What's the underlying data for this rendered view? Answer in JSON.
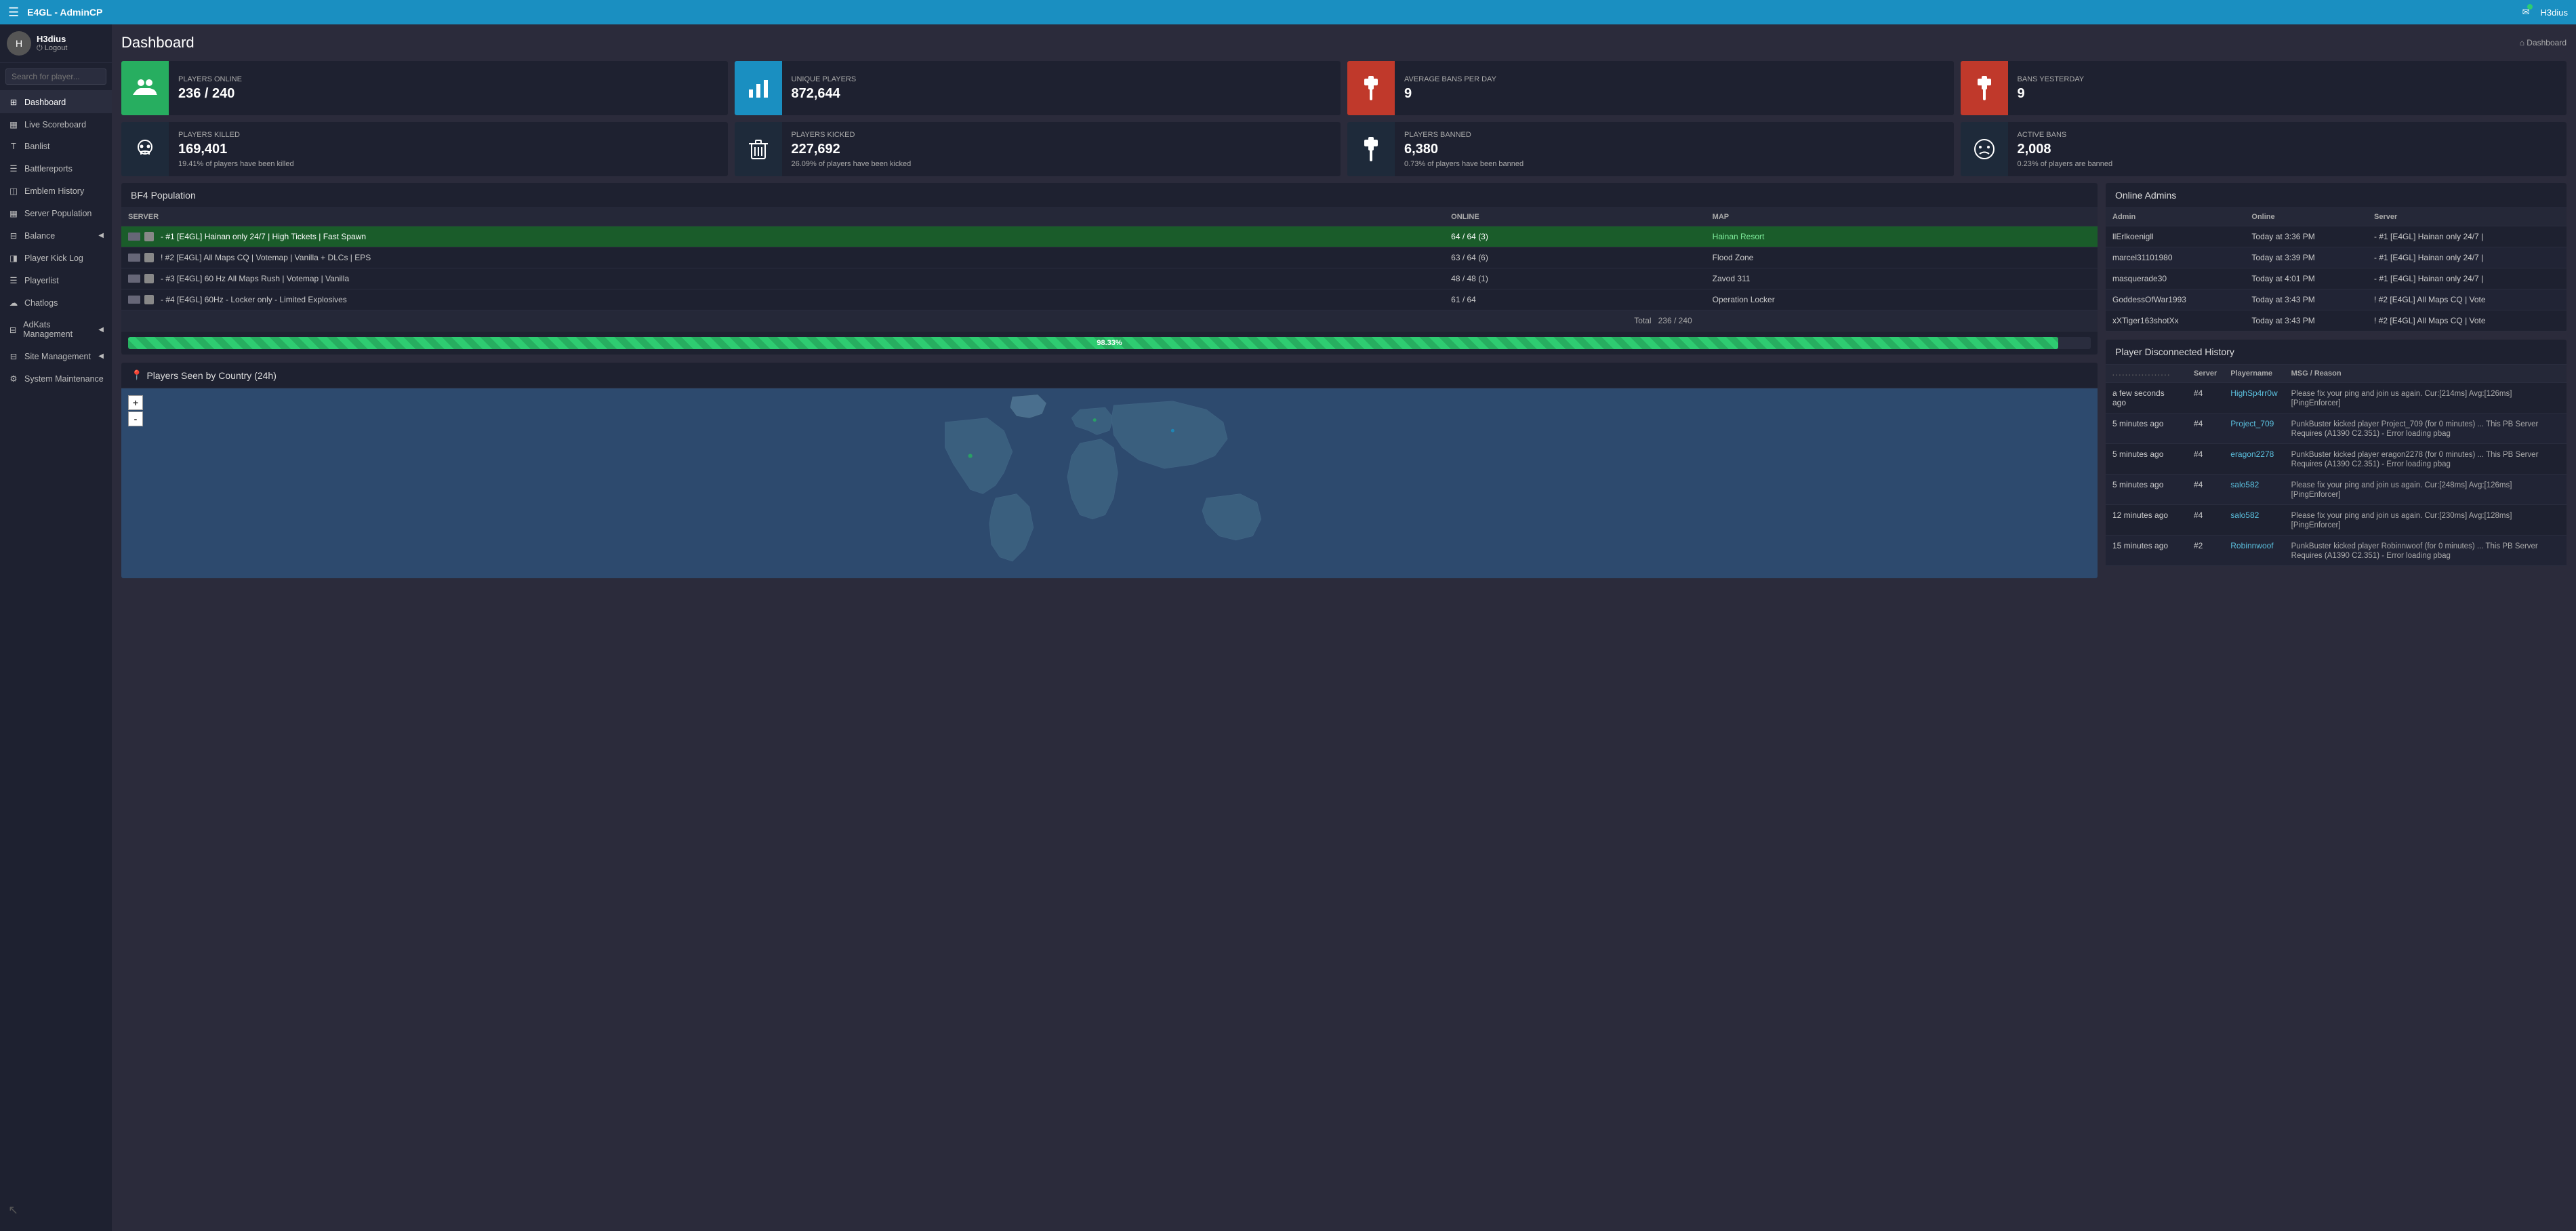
{
  "app": {
    "brand": "E4GL - AdminCP",
    "user": "H3dius"
  },
  "topnav": {
    "brand": "E4GL - AdminCP",
    "user_label": "H3dius"
  },
  "sidebar": {
    "profile": {
      "name": "H3dius",
      "logout": "Logout"
    },
    "search_placeholder": "Search for player...",
    "items": [
      {
        "id": "dashboard",
        "label": "Dashboard",
        "icon": "⊞",
        "active": true
      },
      {
        "id": "live-scoreboard",
        "label": "Live Scoreboard",
        "icon": "▦"
      },
      {
        "id": "banlist",
        "label": "Banlist",
        "icon": "T"
      },
      {
        "id": "battlereports",
        "label": "Battlereports",
        "icon": "☰"
      },
      {
        "id": "emblem-history",
        "label": "Emblem History",
        "icon": "◫"
      },
      {
        "id": "server-population",
        "label": "Server Population",
        "icon": "▦"
      },
      {
        "id": "balance",
        "label": "Balance",
        "icon": "⊟",
        "has_arrow": true
      },
      {
        "id": "player-kick-log",
        "label": "Player Kick Log",
        "icon": "◨"
      },
      {
        "id": "playerlist",
        "label": "Playerlist",
        "icon": "☰"
      },
      {
        "id": "chatlogs",
        "label": "Chatlogs",
        "icon": "☁"
      },
      {
        "id": "adkats-management",
        "label": "AdKats Management",
        "icon": "⊟",
        "has_arrow": true
      },
      {
        "id": "site-management",
        "label": "Site Management",
        "icon": "⊟",
        "has_arrow": true
      },
      {
        "id": "system-maintenance",
        "label": "System Maintenance",
        "icon": "⚙"
      }
    ]
  },
  "page": {
    "title": "Dashboard",
    "breadcrumb": "Dashboard"
  },
  "stats_row1": [
    {
      "id": "players-online",
      "icon": "👥",
      "icon_style": "green",
      "label": "PLAYERS ONLINE",
      "value": "236 / 240",
      "sub": ""
    },
    {
      "id": "unique-players",
      "icon": "📊",
      "icon_style": "teal",
      "label": "UNIQUE PLAYERS",
      "value": "872,644",
      "sub": ""
    },
    {
      "id": "avg-bans",
      "icon": "🔨",
      "icon_style": "red",
      "label": "AVERAGE BANS PER DAY",
      "value": "9",
      "sub": ""
    },
    {
      "id": "bans-yesterday",
      "icon": "🔨",
      "icon_style": "red",
      "label": "BANS YESTERDAY",
      "value": "9",
      "sub": ""
    }
  ],
  "stats_row2": [
    {
      "id": "players-killed",
      "icon": "💀",
      "icon_style": "teal",
      "label": "PLAYERS KILLED",
      "value": "169,401",
      "sub": "19.41% of players have been killed"
    },
    {
      "id": "players-kicked",
      "icon": "🗑",
      "icon_style": "teal",
      "label": "PLAYERS KICKED",
      "value": "227,692",
      "sub": "26.09% of players have been kicked"
    },
    {
      "id": "players-banned",
      "icon": "🔨",
      "icon_style": "teal",
      "label": "PLAYERS BANNED",
      "value": "6,380",
      "sub": "0.73% of players have been banned"
    },
    {
      "id": "active-bans",
      "icon": "☹",
      "icon_style": "teal",
      "label": "ACTIVE BANS",
      "value": "2,008",
      "sub": "0.23% of players are banned"
    }
  ],
  "bf4_population": {
    "title": "BF4 Population",
    "columns": [
      "Server",
      "Online",
      "Map"
    ],
    "servers": [
      {
        "name": "- #1 [E4GL] Hainan only 24/7 | High Tickets | Fast Spawn",
        "online": "64 / 64 (3)",
        "map": "Hainan Resort",
        "highlight": true
      },
      {
        "name": "! #2 [E4GL] All Maps CQ | Votemap | Vanilla + DLCs | EPS",
        "online": "63 / 64 (6)",
        "map": "Flood Zone",
        "highlight": false
      },
      {
        "name": "- #3 [E4GL] 60 Hz All Maps Rush | Votemap | Vanilla",
        "online": "48 / 48 (1)",
        "map": "Zavod 311",
        "highlight": false
      },
      {
        "name": "- #4 [E4GL] 60Hz - Locker only - Limited Explosives",
        "online": "61 / 64",
        "map": "Operation Locker",
        "highlight": false
      }
    ],
    "total_label": "Total",
    "total_value": "236 / 240",
    "progress_pct": "98.33%",
    "progress_width": "98.33"
  },
  "map_section": {
    "title": "Players Seen by Country (24h)",
    "zoom_in": "+",
    "zoom_out": "-"
  },
  "online_admins": {
    "title": "Online Admins",
    "columns": [
      "Admin",
      "Online",
      "Server"
    ],
    "rows": [
      {
        "admin": "llErlkoenigll",
        "online": "Today at 3:36 PM",
        "server": "- #1 [E4GL] Hainan only 24/7 |"
      },
      {
        "admin": "marcel31101980",
        "online": "Today at 3:39 PM",
        "server": "- #1 [E4GL] Hainan only 24/7 |"
      },
      {
        "admin": "masquerade30",
        "online": "Today at 4:01 PM",
        "server": "- #1 [E4GL] Hainan only 24/7 |"
      },
      {
        "admin": "GoddessOfWar1993",
        "online": "Today at 3:43 PM",
        "server": "! #2 [E4GL] All Maps CQ | Vote"
      },
      {
        "admin": "xXTiger163shotXx",
        "online": "Today at 3:43 PM",
        "server": "! #2 [E4GL] All Maps CQ | Vote"
      }
    ]
  },
  "disconnected_history": {
    "title": "Player Disconnected History",
    "columns": [
      "",
      "Server",
      "Playername",
      "MSG / Reason"
    ],
    "rows": [
      {
        "time": "a few seconds ago",
        "server": "#4",
        "player": "HighSp4rr0w",
        "msg": "Please fix your ping and join us again. Cur:[214ms] Avg:[126ms] [PingEnforcer]"
      },
      {
        "time": "5 minutes ago",
        "server": "#4",
        "player": "Project_709",
        "msg": "PunkBuster kicked player Project_709 (for 0 minutes) ... This PB Server Requires (A1390 C2.351) - Error loading pbag"
      },
      {
        "time": "5 minutes ago",
        "server": "#4",
        "player": "eragon2278",
        "msg": "PunkBuster kicked player eragon2278 (for 0 minutes) ... This PB Server Requires (A1390 C2.351) - Error loading pbag"
      },
      {
        "time": "5 minutes ago",
        "server": "#4",
        "player": "salo582",
        "msg": "Please fix your ping and join us again. Cur:[248ms] Avg:[126ms] [PingEnforcer]"
      },
      {
        "time": "12 minutes ago",
        "server": "#4",
        "player": "salo582",
        "msg": "Please fix your ping and join us again. Cur:[230ms] Avg:[128ms] [PingEnforcer]"
      },
      {
        "time": "15 minutes ago",
        "server": "#2",
        "player": "Robinnwoof",
        "msg": "PunkBuster kicked player Robinnwoof (for 0 minutes) ... This PB Server Requires (A1390 C2.351) - Error loading pbag"
      }
    ]
  }
}
